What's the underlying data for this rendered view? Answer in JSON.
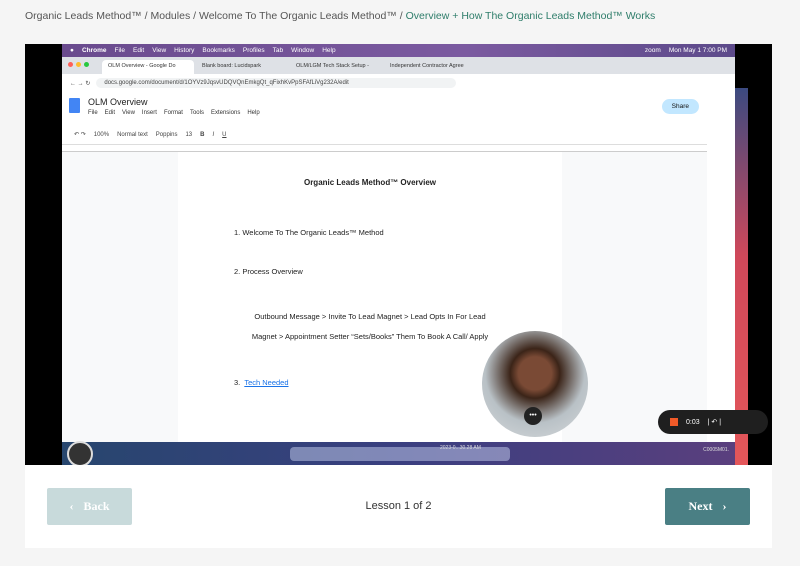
{
  "breadcrumb": {
    "items": [
      "Organic Leads Method™",
      "Modules",
      "Welcome To The Organic Leads Method™"
    ],
    "current": "Overview + How The Organic Leads Method™ Works"
  },
  "video": {
    "menubar": {
      "items": [
        "Chrome",
        "File",
        "Edit",
        "View",
        "History",
        "Bookmarks",
        "Profiles",
        "Tab",
        "Window",
        "Help"
      ],
      "clock": "Mon May 1  7:00 PM",
      "zoom": "zoom"
    },
    "tabs": [
      "OLM Overview - Google Do",
      "Blank board: Lucidspark",
      "OLM/LGM Tech Stack Setup -",
      "Independent Contractor Agree"
    ],
    "url": "docs.google.com/document/d/1OYVz9JqsvUDQVQnEmkgQt_qFixhKvPpSFAfLiVg232A/edit",
    "doc": {
      "title": "OLM Overview",
      "menu": [
        "File",
        "Edit",
        "View",
        "Insert",
        "Format",
        "Tools",
        "Extensions",
        "Help"
      ],
      "share": "Share",
      "toolbar": [
        "100%",
        "Normal text",
        "Poppins",
        "13"
      ],
      "heading": "Organic Leads Method™ Overview",
      "item1": "1.  Welcome To The Organic Leads™ Method",
      "item2": "2.  Process Overview",
      "process1": "Outbound Message > Invite To Lead Magnet > Lead Opts In For Lead",
      "process2": "Magnet > Appointment Setter “Sets/Books” Them To Book A Call/ Apply",
      "item3_num": "3.",
      "item3": "Tech Needed"
    },
    "recorder": {
      "time": "0:03"
    },
    "dock_timestamp": "2023-0...30.28 AM",
    "dock_file": "C0005M01."
  },
  "nav": {
    "back": "Back",
    "next": "Next",
    "lesson": "Lesson 1 of 2"
  },
  "colors": {
    "accent": "#2e7d6a",
    "next_bg": "#4a7f84",
    "back_bg": "#c8dadb"
  }
}
